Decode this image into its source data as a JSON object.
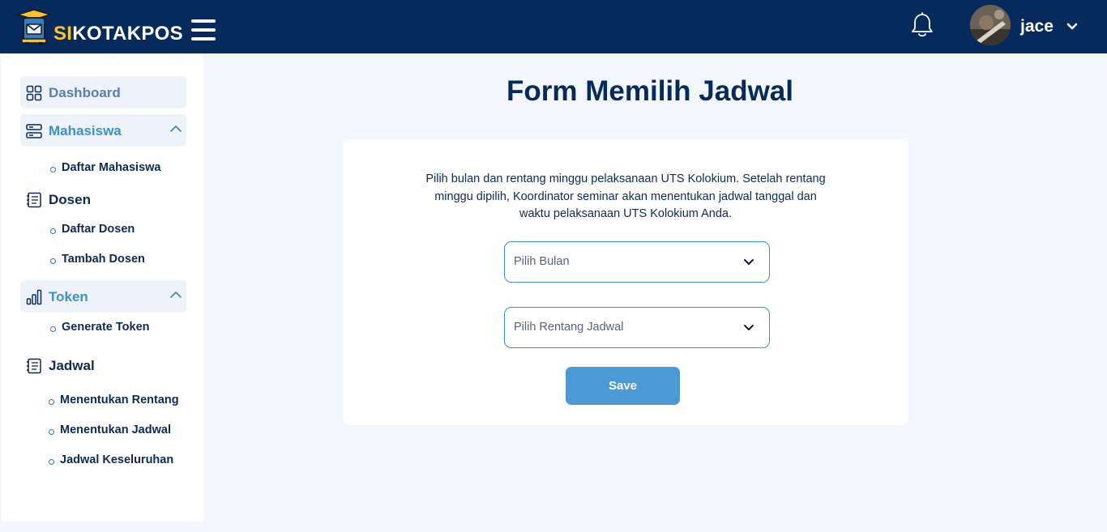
{
  "header": {
    "brand_accent": "SI",
    "brand_rest": "KOTAKPOS",
    "username": "jace",
    "colors": {
      "bar": "#062a5b",
      "accent": "#f7c52b"
    },
    "icons": [
      "logo-icon",
      "menu-icon",
      "bell-icon",
      "avatar",
      "chevron-down-icon"
    ]
  },
  "sidebar": {
    "dashboard": "Dashboard",
    "mahasiswa": {
      "label": "Mahasiswa",
      "items": [
        "Daftar Mahasiswa"
      ]
    },
    "dosen": {
      "label": "Dosen",
      "items": [
        "Daftar Dosen",
        "Tambah Dosen"
      ]
    },
    "token": {
      "label": "Token",
      "items": [
        "Generate Token"
      ]
    },
    "jadwal": {
      "label": "Jadwal",
      "items": [
        "Menentukan Rentang",
        "Menentukan Jadwal",
        "Jadwal Keseluruhan"
      ]
    }
  },
  "main": {
    "title": "Form Memilih Jadwal",
    "description": "Pilih bulan dan rentang minggu pelaksanaan UTS Kolokium. Setelah rentang minggu dipilih, Koordinator seminar akan menentukan jadwal tanggal dan waktu pelaksanaan UTS Kolokium Anda.",
    "select_month_placeholder": "Pilih Bulan",
    "select_range_placeholder": "Pilih Rentang Jadwal",
    "save_label": "Save",
    "colors": {
      "primary": "#4b9ad6",
      "border": "#3f8fc9"
    }
  }
}
